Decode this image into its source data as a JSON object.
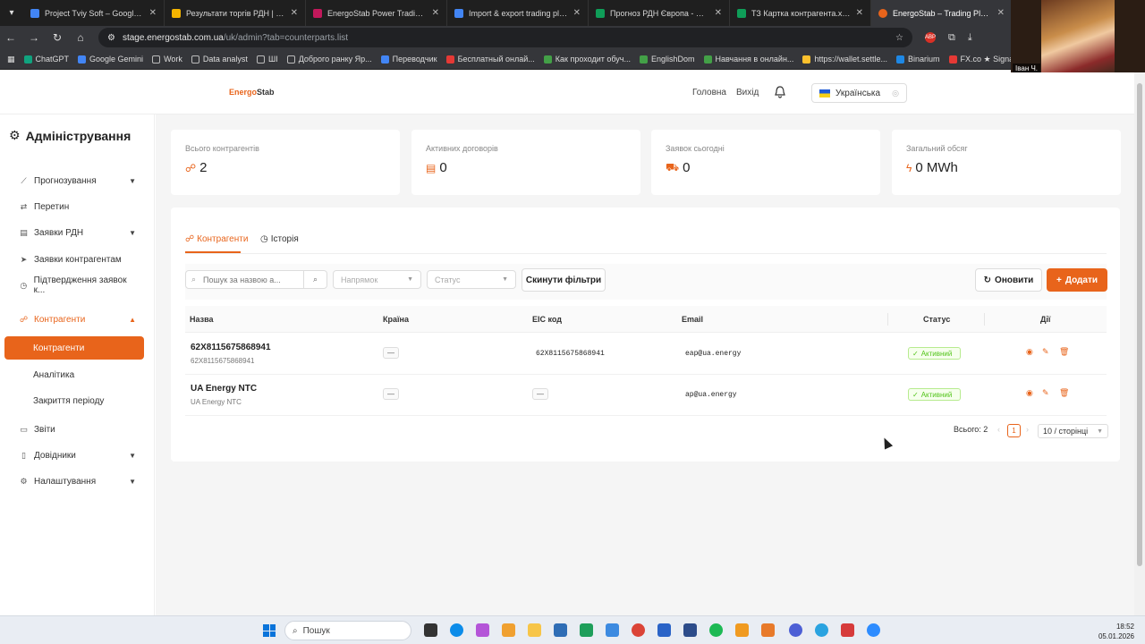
{
  "browser": {
    "tabs": [
      {
        "title": "Project Tviy Soft – Google Диск",
        "color": "#4285f4"
      },
      {
        "title": "Результати торгів РДН | Опера",
        "color": "#f4b400"
      },
      {
        "title": "EnergoStab Power Trading Platf",
        "color": "#c2185b"
      },
      {
        "title": "Import & export trading platfo",
        "color": "#4285f4"
      },
      {
        "title": "Прогноз РДН Європа - Googl",
        "color": "#0f9d58"
      },
      {
        "title": "ТЗ Картка контрагента.xlsx - G",
        "color": "#0f9d58"
      },
      {
        "title": "EnergoStab – Trading Platform",
        "color": "#e8641b"
      }
    ],
    "url_host": "stage.energostab.com.ua",
    "url_path": "/uk/admin?tab=counterparts.list",
    "bookmarks": [
      {
        "label": "ChatGPT",
        "color": "#10a37f"
      },
      {
        "label": "Google Gemini",
        "color": "#4285f4"
      },
      {
        "label": "Work",
        "color": "#bbbbbb"
      },
      {
        "label": "Data analyst",
        "color": "#bbbbbb"
      },
      {
        "label": "ШІ",
        "color": "#bbbbbb"
      },
      {
        "label": "Доброго ранку Яр...",
        "color": "#bbbbbb"
      },
      {
        "label": "Переводчик",
        "color": "#4285f4"
      },
      {
        "label": "Бесплатный онлай...",
        "color": "#e53935"
      },
      {
        "label": "Как проходит обуч...",
        "color": "#43a047"
      },
      {
        "label": "EnglishDom",
        "color": "#43a047"
      },
      {
        "label": "Навчання в онлайн...",
        "color": "#43a047"
      },
      {
        "label": "https://wallet.settle...",
        "color": "#fbc02d"
      },
      {
        "label": "Binarium",
        "color": "#1e88e5"
      },
      {
        "label": "FX.co ★ Signals EUR...",
        "color": "#e53935"
      }
    ],
    "webcam_name": "Іван Ч."
  },
  "header": {
    "logo_energo": "Energo",
    "logo_stab": "Stab",
    "nav_home": "Головна",
    "nav_logout": "Вихід",
    "language": "Українська"
  },
  "sidebar": {
    "title": "Адміністрування",
    "items": [
      {
        "label": "Прогнозування",
        "icon": "chart-icon",
        "chevron": "down"
      },
      {
        "label": "Перетин",
        "icon": "swap-icon"
      },
      {
        "label": "Заявки РДН",
        "icon": "document-icon",
        "chevron": "down"
      },
      {
        "label": "Заявки контрагентам",
        "icon": "send-icon"
      },
      {
        "label": "Підтвердження заявок к...",
        "icon": "check-circle-icon"
      },
      {
        "label": "Контрагенти",
        "icon": "users-icon",
        "chevron": "up"
      }
    ],
    "sub_items": [
      "Контрагенти",
      "Аналітика",
      "Закриття періоду"
    ],
    "bottom_items": [
      {
        "label": "Звіти",
        "icon": "file-icon"
      },
      {
        "label": "Довідники",
        "icon": "book-icon",
        "chevron": "down"
      },
      {
        "label": "Налаштування",
        "icon": "gear-icon",
        "chevron": "down"
      }
    ]
  },
  "stats": [
    {
      "label": "Всього контрагентів",
      "value": "2"
    },
    {
      "label": "Активних договорів",
      "value": "0"
    },
    {
      "label": "Заявок сьогодні",
      "value": "0"
    },
    {
      "label": "Загальний обсяг",
      "value": "0 MWh"
    }
  ],
  "panel": {
    "tab_counterparts": "Контрагенти",
    "tab_history": "Історія",
    "search_placeholder": "Пошук за назвою а...",
    "direction_placeholder": "Напрямок",
    "status_placeholder": "Статус",
    "reset_button": "Скинути фільтри",
    "refresh_button": "Оновити",
    "add_button": "Додати"
  },
  "table": {
    "columns": [
      "Назва",
      "Країна",
      "EIC код",
      "Email",
      "Статус",
      "Дії"
    ],
    "rows": [
      {
        "name": "62X8115675868941",
        "subname": "62X8115675868941",
        "country": "—",
        "eic": "62X8115675868941",
        "email": "eap@ua.energy",
        "status": "Активний"
      },
      {
        "name": "UA Energy NTC",
        "subname": "UA Energy NTC",
        "country": "—",
        "eic": "—",
        "email": "ap@ua.energy",
        "status": "Активний"
      }
    ]
  },
  "pagination": {
    "total": "Всього: 2",
    "current_page": "1",
    "page_size": "10 / сторінці"
  },
  "taskbar": {
    "search": "Пошук",
    "time": "18:52",
    "date": "05.01.2026"
  },
  "colors": {
    "accent": "#e8641b",
    "success": "#52c41a"
  }
}
